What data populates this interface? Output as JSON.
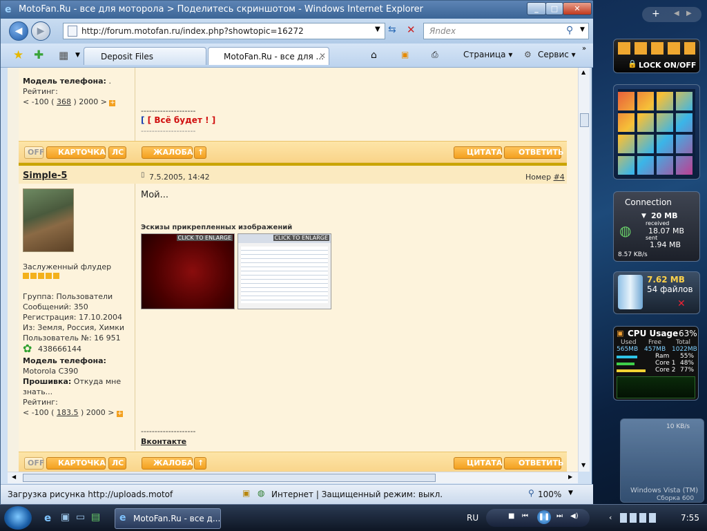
{
  "window": {
    "title": "MotoFan.Ru - все для моторола > Поделитесь скриншотом - Windows Internet Explorer"
  },
  "addressbar": {
    "url": "http://forum.motofan.ru/index.php?showtopic=16272",
    "search_placeholder": "Яndex"
  },
  "tabs": [
    {
      "label": "Deposit Files"
    },
    {
      "label": "MotoFan.Ru - все для ..."
    }
  ],
  "commandbar": {
    "page_label": "Страница",
    "service_label": "Сервис"
  },
  "post1": {
    "phone_label": "Модель телефона:",
    "phone_value": ".",
    "rating_label": "Рейтинг:",
    "rating_left": "< -100 (",
    "rating_value": "368",
    "rating_right": ") 2000 >",
    "sig_line": "--------------------",
    "sig_text": "[ Всё будет ! ]",
    "sig_line2": "--------------------",
    "buttons": {
      "off": "OFF",
      "card": "КАРТОЧКА",
      "pm": "ЛС",
      "complaint": "ЖАЛОБА",
      "quote": "ЦИТАТА",
      "reply": "ОТВЕТИТЬ"
    }
  },
  "post2": {
    "author": "Simple-5",
    "datetime": "7.5.2005, 14:42",
    "number_label": "Номер",
    "number": "#4",
    "body": "Мой...",
    "attachments_title": "Эскизы прикрепленных изображений",
    "thumb1_label": "CLICK TO ENLARGE",
    "thumb2_label": "CLICK TO ENLARGE",
    "user_title": "Заслуженный флудер",
    "group": "Группа: Пользователи",
    "posts": "Сообщений: 350",
    "registered": "Регистрация: 17.10.2004",
    "from": "Из: Земля, Россия, Химки",
    "user_no": "Пользователь №: 16 951",
    "icq": "438666144",
    "phone_label": "Модель телефона:",
    "phone_value": "Motorola C390",
    "firmware_label": "Прошивка:",
    "firmware_value": "Откуда мне",
    "firmware_value2": "знать...",
    "rating_label": "Рейтинг:",
    "rating_left": "< -100 (",
    "rating_value": "183.5",
    "rating_right": ") 2000 >",
    "sig_line": "--------------------",
    "sig_link": "Вконтакте",
    "buttons": {
      "off": "OFF",
      "card": "КАРТОЧКА",
      "pm": "ЛС",
      "complaint": "ЖАЛОБА",
      "quote": "ЦИТАТА",
      "reply": "ОТВЕТИТЬ"
    }
  },
  "statusbar": {
    "loading": "Загрузка рисунка http://uploads.motof",
    "zone": "Интернет | Защищенный режим: выкл.",
    "zoom": "100%"
  },
  "taskbar": {
    "task": "MotoFan.Ru - все д...",
    "lang": "RU",
    "clock": "7:55"
  },
  "sidebar": {
    "lock_label": "LOCK ON/OFF",
    "connection": {
      "title": "Connection",
      "received_value": "20 MB",
      "received_label": "received",
      "received2": "18.07 MB",
      "sent_label": "sent",
      "sent_value": "1.94 MB",
      "speed": "8.57 KB/s"
    },
    "recycle": {
      "size": "7.62 MB",
      "files": "54 файлов"
    },
    "cpu": {
      "title": "CPU Usage",
      "percent": "63%",
      "h_used": "Used",
      "h_free": "Free",
      "h_total": "Total",
      "used": "565MB",
      "free": "457MB",
      "total": "1022MB",
      "ram_label": "Ram",
      "ram_pct": "55%",
      "core1_label": "Core 1",
      "core1_pct": "48%",
      "core2_label": "Core 2",
      "core2_pct": "77%"
    },
    "net": {
      "speed": "10 KB/s",
      "watermark1": "Windows Vista (TM)",
      "watermark2": "Сборка 600"
    }
  },
  "colors": {
    "forum_bg": "#fdf3dc",
    "button_orange": "#f3a01f",
    "sig_red": "#d01010",
    "sig_blue": "#1a3fb0"
  }
}
